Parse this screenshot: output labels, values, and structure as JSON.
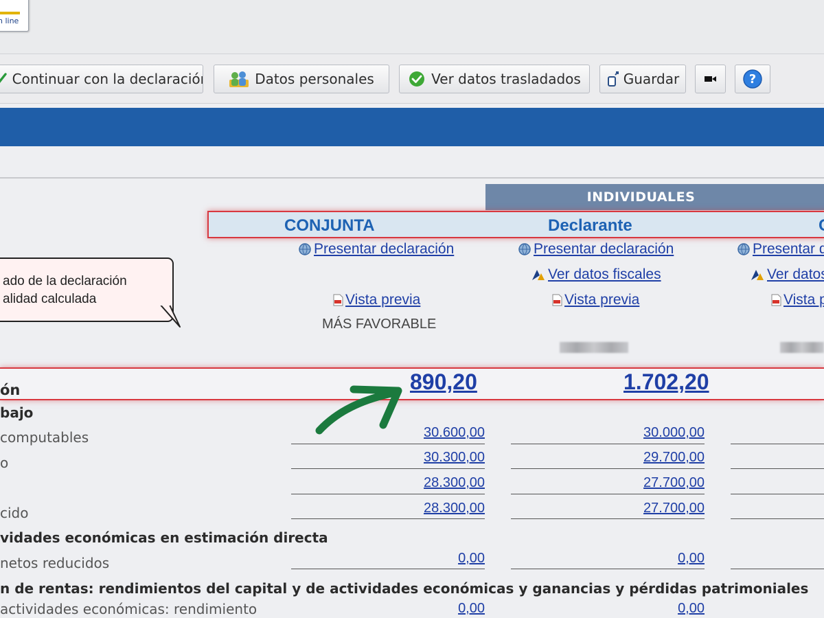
{
  "app": {
    "logo_text": "n line"
  },
  "toolbar": {
    "continuar": "Continuar con la declaración",
    "datos_personales": "Datos personales",
    "ver_datos": "Ver datos trasladados",
    "guardar": "Guardar"
  },
  "header": {
    "individuales": "INDIVIDUALES",
    "conjunta": "CONJUNTA",
    "declarante": "Declarante",
    "third": "C"
  },
  "actions": {
    "presentar": "Presentar declaración",
    "presentar_cut": "Presentar d",
    "ver_fiscales": "Ver datos fiscales",
    "ver_cut": "Ver datos",
    "vista_previa": "Vista previa",
    "vista_cut": "Vista p",
    "mas_favorable": "MÁS FAVORABLE"
  },
  "tooltip": {
    "line1": "ado de la declaración",
    "line2": "alidad calculada"
  },
  "result": {
    "label": "ón",
    "conjunta": "890,20",
    "declarante": "1.702,20"
  },
  "rows": {
    "sec_trabajo": "bajo",
    "computables": {
      "label": "computables",
      "conjunta": "30.600,00",
      "declarante": "30.000,00"
    },
    "r2": {
      "label": "o",
      "conjunta": "30.300,00",
      "declarante": "29.700,00"
    },
    "r3": {
      "label": "",
      "conjunta": "28.300,00",
      "declarante": "27.700,00"
    },
    "r4": {
      "label": "cido",
      "conjunta": "28.300,00",
      "declarante": "27.700,00"
    },
    "sec_actividades": "vidades económicas en estimación directa",
    "netos": {
      "label": "netos reducidos",
      "conjunta": "0,00",
      "declarante": "0,00"
    },
    "sec_rentas": "n de rentas: rendimientos del capital y de actividades económicas y ganancias y pérdidas patrimoniales",
    "actividades": {
      "label": "actividades económicas: rendimiento",
      "conjunta": "0,00",
      "declarante": "0,00"
    }
  },
  "colors": {
    "band_blue": "#1f5ea8",
    "highlight_red": "#d8383f",
    "arrow_green": "#1b7a3e",
    "link_blue": "#1f3fa6"
  }
}
